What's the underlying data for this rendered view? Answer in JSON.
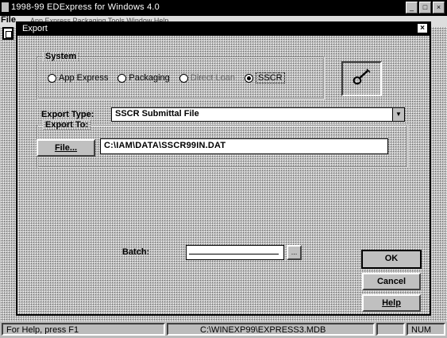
{
  "app": {
    "title": "1998-99 EDExpress for Windows 4.0",
    "caption_buttons": [
      "_",
      "□",
      "×"
    ],
    "menu_file": "File",
    "menu_rest": "App Express Packaging Tools Window Help"
  },
  "dialog": {
    "title": "Export",
    "close_glyph": "×",
    "system_group": {
      "legend": "System",
      "options": [
        {
          "label": "App Express",
          "selected": false,
          "disabled": false
        },
        {
          "label": "Packaging",
          "selected": false,
          "disabled": false
        },
        {
          "label": "Direct Loan",
          "selected": false,
          "disabled": true
        },
        {
          "label": "SSCR",
          "selected": true,
          "disabled": false
        }
      ]
    },
    "logo_icon": "ssc-pen-icon",
    "export_type": {
      "label": "Export Type:",
      "value": "SSCR Submittal File",
      "arrow": "▼"
    },
    "export_to": {
      "legend": "Export To:",
      "file_button": "File...",
      "path": "C:\\IAM\\DATA\\SSCR99IN.DAT"
    },
    "batch": {
      "label": "Batch:",
      "value": "",
      "button": "..."
    },
    "buttons": {
      "ok": "OK",
      "cancel": "Cancel",
      "help": "Help"
    }
  },
  "statusbar": {
    "help_text": "For Help, press F1",
    "db_path": "C:\\WINEXP99\\EXPRESS3.MDB",
    "blank": "",
    "num": "NUM"
  }
}
